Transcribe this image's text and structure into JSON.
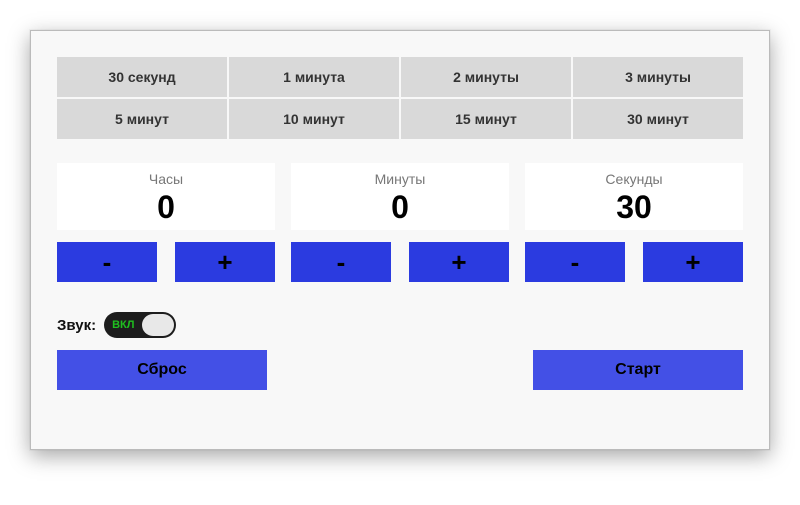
{
  "presets": [
    {
      "label": "30 секунд"
    },
    {
      "label": "1 минута"
    },
    {
      "label": "2 минуты"
    },
    {
      "label": "3 минуты"
    },
    {
      "label": "5 минут"
    },
    {
      "label": "10 минут"
    },
    {
      "label": "15 минут"
    },
    {
      "label": "30 минут"
    }
  ],
  "units": {
    "hours": {
      "label": "Часы",
      "value": "0"
    },
    "minutes": {
      "label": "Минуты",
      "value": "0"
    },
    "seconds": {
      "label": "Секунды",
      "value": "30"
    }
  },
  "steppers": {
    "minus": "-",
    "plus": "+"
  },
  "sound": {
    "label": "Звук:",
    "state_text": "ВКЛ",
    "on": true
  },
  "actions": {
    "reset": "Сброс",
    "start": "Старт"
  },
  "colors": {
    "accent": "#2b3be0",
    "action": "#4350e6",
    "toggle_on": "#1fbf1f"
  }
}
